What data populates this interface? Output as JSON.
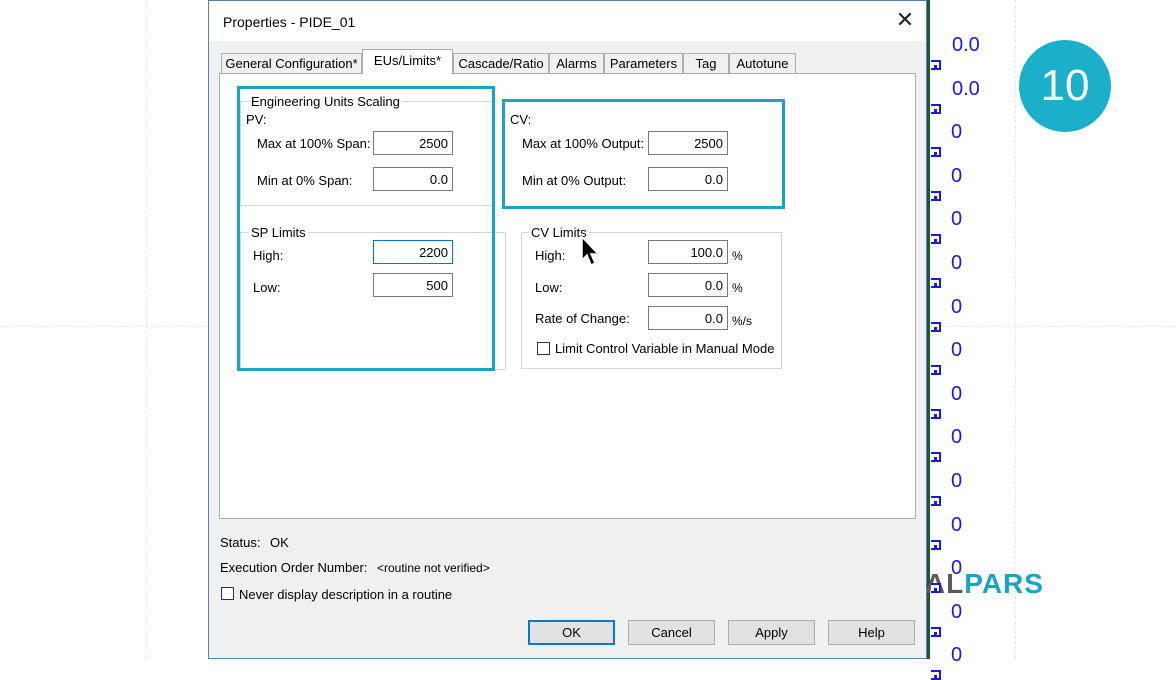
{
  "dialog": {
    "title": "Properties - PIDE_01",
    "tabs": [
      {
        "label": "General Configuration*"
      },
      {
        "label": "EUs/Limits*"
      },
      {
        "label": "Cascade/Ratio"
      },
      {
        "label": "Alarms"
      },
      {
        "label": "Parameters"
      },
      {
        "label": "Tag"
      },
      {
        "label": "Autotune"
      }
    ],
    "active_tab": "EUs/Limits*",
    "eu_scaling": {
      "title": "Engineering Units Scaling",
      "pv_label": "PV:",
      "max_label": "Max at 100% Span:",
      "max_value": "2500",
      "min_label": "Min at 0% Span:",
      "min_value": "0.0"
    },
    "cv": {
      "label": "CV:",
      "max_label": "Max at 100% Output:",
      "max_value": "2500",
      "min_label": "Min at 0% Output:",
      "min_value": "0.0"
    },
    "sp_limits": {
      "title": "SP Limits",
      "high_label": "High:",
      "high_value": "2200",
      "low_label": "Low:",
      "low_value": "500"
    },
    "cv_limits": {
      "title": "CV Limits",
      "high_label": "High:",
      "high_value": "100.0",
      "high_unit": "%",
      "low_label": "Low:",
      "low_value": "0.0",
      "low_unit": "%",
      "roc_label": "Rate of Change:",
      "roc_value": "0.0",
      "roc_unit": "%/s",
      "limit_manual_label": "Limit Control Variable in Manual Mode",
      "limit_manual_checked": false
    },
    "status_label": "Status:",
    "status_value": "OK",
    "exec_order_label": "Execution Order Number:",
    "exec_order_value": "<routine not verified>",
    "never_display_label": "Never display description in a routine",
    "buttons": {
      "ok": "OK",
      "cancel": "Cancel",
      "apply": "Apply",
      "help": "Help"
    }
  },
  "background": {
    "values": [
      "0.0",
      "0.0",
      "0",
      "0",
      "0",
      "0",
      "0",
      "0",
      "0",
      "0",
      "0",
      "0",
      "0",
      "0",
      "0"
    ],
    "step_badge": "10",
    "logo_part1": "REAL",
    "logo_part2": "PARS"
  },
  "colors": {
    "highlight": "#1aa3c4",
    "value_blue": "#1a1ad8",
    "badge": "#1ab0c9"
  }
}
